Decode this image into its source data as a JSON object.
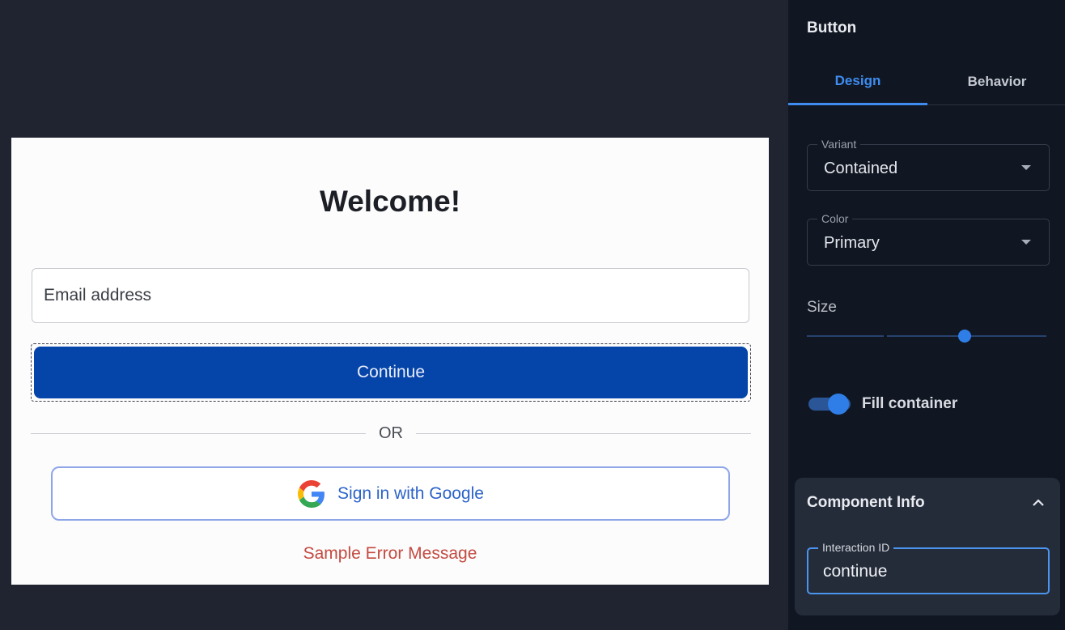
{
  "preview": {
    "title": "Welcome!",
    "email_placeholder": "Email address",
    "continue_label": "Continue",
    "divider_text": "OR",
    "google_label": "Sign in with Google",
    "error_message": "Sample Error Message"
  },
  "panel": {
    "title": "Button",
    "tabs": [
      {
        "label": "Design",
        "active": true
      },
      {
        "label": "Behavior",
        "active": false
      }
    ],
    "variant": {
      "label": "Variant",
      "value": "Contained"
    },
    "color": {
      "label": "Color",
      "value": "Primary"
    },
    "size": {
      "label": "Size",
      "value_fraction": 0.66
    },
    "fill_container": {
      "label": "Fill container",
      "enabled": true
    }
  },
  "component_info": {
    "title": "Component Info",
    "interaction_id_label": "Interaction ID",
    "interaction_id_value": "continue"
  },
  "colors": {
    "primary": "#0544a8",
    "accent": "#3e8cf0",
    "error": "#c44a40"
  },
  "icons": {
    "google": "google-g-icon",
    "caret": "chevron-down-icon",
    "collapse": "chevron-up-icon"
  }
}
